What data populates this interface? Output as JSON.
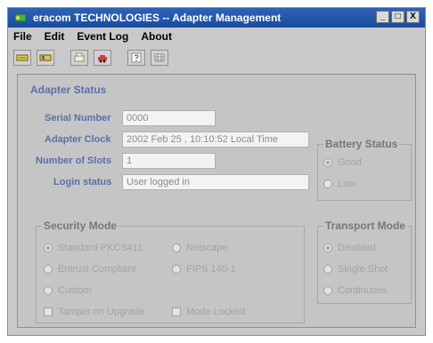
{
  "window": {
    "title": "eracom TECHNOLOGIES -- Adapter Management",
    "buttons": {
      "minimize": "_",
      "maximize": "□",
      "close": "X"
    }
  },
  "menu": {
    "items": [
      {
        "label": "File"
      },
      {
        "label": "Edit"
      },
      {
        "label": "Event Log"
      },
      {
        "label": "About"
      }
    ]
  },
  "toolbar": {
    "icons": [
      "adapter-icon",
      "card-icon",
      "printer-icon",
      "car-icon",
      "help-icon",
      "grid-icon"
    ]
  },
  "adapter_status": {
    "section_title": "Adapter Status",
    "serial_number": {
      "label": "Serial Number",
      "value": "0000"
    },
    "adapter_clock": {
      "label": "Adapter Clock",
      "value": "2002 Feb 25 , 10:10:52 Local Time"
    },
    "number_of_slots": {
      "label": "Number of Slots",
      "value": "1"
    },
    "login_status": {
      "label": "Login status",
      "value": "User logged in"
    }
  },
  "battery_status": {
    "title": "Battery Status",
    "options": [
      {
        "label": "Good",
        "selected": true
      },
      {
        "label": "Low",
        "selected": false
      }
    ]
  },
  "security_mode": {
    "title": "Security Mode",
    "options": [
      {
        "label": "Standard PKCS#11",
        "selected": true
      },
      {
        "label": "Netscape",
        "selected": false
      },
      {
        "label": "Entrust Compliant",
        "selected": false
      },
      {
        "label": "FIPS 140-1",
        "selected": false
      },
      {
        "label": "Custom",
        "selected": false
      }
    ],
    "checkboxes": [
      {
        "label": "Tamper on Upgrade",
        "checked": false
      },
      {
        "label": "Mode Locked",
        "checked": false
      }
    ]
  },
  "transport_mode": {
    "title": "Transport Mode",
    "options": [
      {
        "label": "Disabled",
        "selected": true
      },
      {
        "label": "Single Shot",
        "selected": false
      },
      {
        "label": "Continuous",
        "selected": false
      }
    ]
  }
}
